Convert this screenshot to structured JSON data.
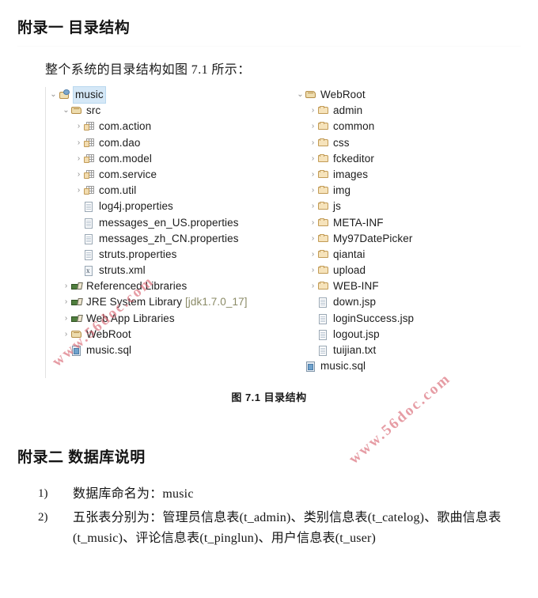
{
  "document": {
    "appendix1_heading": "附录一 目录结构",
    "appendix2_heading": "附录二 数据库说明",
    "intro_paragraph": "整个系统的目录结构如图 7.1 所示：",
    "figure_caption": "图 7.1 目录结构",
    "watermark": "www.56doc.com"
  },
  "figure": {
    "left_tree": [
      {
        "label": "music",
        "indent": 0,
        "arrow": "expanded",
        "icon": "project-icon",
        "selected": true
      },
      {
        "label": "src",
        "indent": 1,
        "arrow": "expanded",
        "icon": "source-folder-icon",
        "selected": false
      },
      {
        "label": "com.action",
        "indent": 2,
        "arrow": "collapsed",
        "icon": "package-icon",
        "selected": false
      },
      {
        "label": "com.dao",
        "indent": 2,
        "arrow": "collapsed",
        "icon": "package-icon",
        "selected": false
      },
      {
        "label": "com.model",
        "indent": 2,
        "arrow": "collapsed",
        "icon": "package-icon",
        "selected": false
      },
      {
        "label": "com.service",
        "indent": 2,
        "arrow": "collapsed",
        "icon": "package-icon",
        "selected": false
      },
      {
        "label": "com.util",
        "indent": 2,
        "arrow": "collapsed",
        "icon": "package-icon",
        "selected": false
      },
      {
        "label": "log4j.properties",
        "indent": 2,
        "arrow": "none",
        "icon": "file-icon",
        "selected": false
      },
      {
        "label": "messages_en_US.properties",
        "indent": 2,
        "arrow": "none",
        "icon": "file-icon",
        "selected": false
      },
      {
        "label": "messages_zh_CN.properties",
        "indent": 2,
        "arrow": "none",
        "icon": "file-icon",
        "selected": false
      },
      {
        "label": "struts.properties",
        "indent": 2,
        "arrow": "none",
        "icon": "file-icon",
        "selected": false
      },
      {
        "label": "struts.xml",
        "indent": 2,
        "arrow": "none",
        "icon": "xml-file-icon",
        "selected": false
      },
      {
        "label": "Referenced Libraries",
        "indent": 1,
        "arrow": "collapsed",
        "icon": "library-icon",
        "selected": false
      },
      {
        "label": "JRE System Library",
        "sublabel": "[jdk1.7.0_17]",
        "indent": 1,
        "arrow": "collapsed",
        "icon": "library-icon",
        "selected": false
      },
      {
        "label": "Web App Libraries",
        "indent": 1,
        "arrow": "collapsed",
        "icon": "library-icon",
        "selected": false
      },
      {
        "label": "WebRoot",
        "indent": 1,
        "arrow": "collapsed",
        "icon": "source-folder-icon",
        "selected": false
      },
      {
        "label": "music.sql",
        "indent": 1,
        "arrow": "none",
        "icon": "sql-file-icon",
        "selected": false
      }
    ],
    "right_tree": [
      {
        "label": "WebRoot",
        "indent": 0,
        "arrow": "expanded",
        "icon": "source-folder-icon"
      },
      {
        "label": "admin",
        "indent": 1,
        "arrow": "collapsed",
        "icon": "folder-icon"
      },
      {
        "label": "common",
        "indent": 1,
        "arrow": "collapsed",
        "icon": "folder-icon"
      },
      {
        "label": "css",
        "indent": 1,
        "arrow": "collapsed",
        "icon": "folder-icon"
      },
      {
        "label": "fckeditor",
        "indent": 1,
        "arrow": "collapsed",
        "icon": "folder-icon"
      },
      {
        "label": "images",
        "indent": 1,
        "arrow": "collapsed",
        "icon": "folder-icon"
      },
      {
        "label": "img",
        "indent": 1,
        "arrow": "collapsed",
        "icon": "folder-icon"
      },
      {
        "label": "js",
        "indent": 1,
        "arrow": "collapsed",
        "icon": "folder-icon"
      },
      {
        "label": "META-INF",
        "indent": 1,
        "arrow": "collapsed",
        "icon": "folder-icon"
      },
      {
        "label": "My97DatePicker",
        "indent": 1,
        "arrow": "collapsed",
        "icon": "folder-icon"
      },
      {
        "label": "qiantai",
        "indent": 1,
        "arrow": "collapsed",
        "icon": "folder-icon"
      },
      {
        "label": "upload",
        "indent": 1,
        "arrow": "collapsed",
        "icon": "folder-icon"
      },
      {
        "label": "WEB-INF",
        "indent": 1,
        "arrow": "collapsed",
        "icon": "folder-icon"
      },
      {
        "label": "down.jsp",
        "indent": 1,
        "arrow": "none",
        "icon": "file-icon"
      },
      {
        "label": "loginSuccess.jsp",
        "indent": 1,
        "arrow": "none",
        "icon": "file-icon"
      },
      {
        "label": "logout.jsp",
        "indent": 1,
        "arrow": "none",
        "icon": "file-icon"
      },
      {
        "label": "tuijian.txt",
        "indent": 1,
        "arrow": "none",
        "icon": "file-icon"
      },
      {
        "label": "music.sql",
        "indent": 0,
        "arrow": "none",
        "icon": "sql-file-icon"
      }
    ]
  },
  "database_list": [
    {
      "num": "1)",
      "text": "数据库命名为：music",
      "mono_part": "music"
    },
    {
      "num": "2)",
      "text": "五张表分别为：管理员信息表(t_admin)、类别信息表(t_catelog)、歌曲信息表(t_music)、评论信息表(t_pinglun)、用户信息表(t_user)"
    }
  ],
  "colors": {
    "folder": "#f6e3bb",
    "folder_border": "#c29b56",
    "selection": "#d5e8f7",
    "watermark": "#d6606c",
    "sublabel": "#8a8a66"
  }
}
